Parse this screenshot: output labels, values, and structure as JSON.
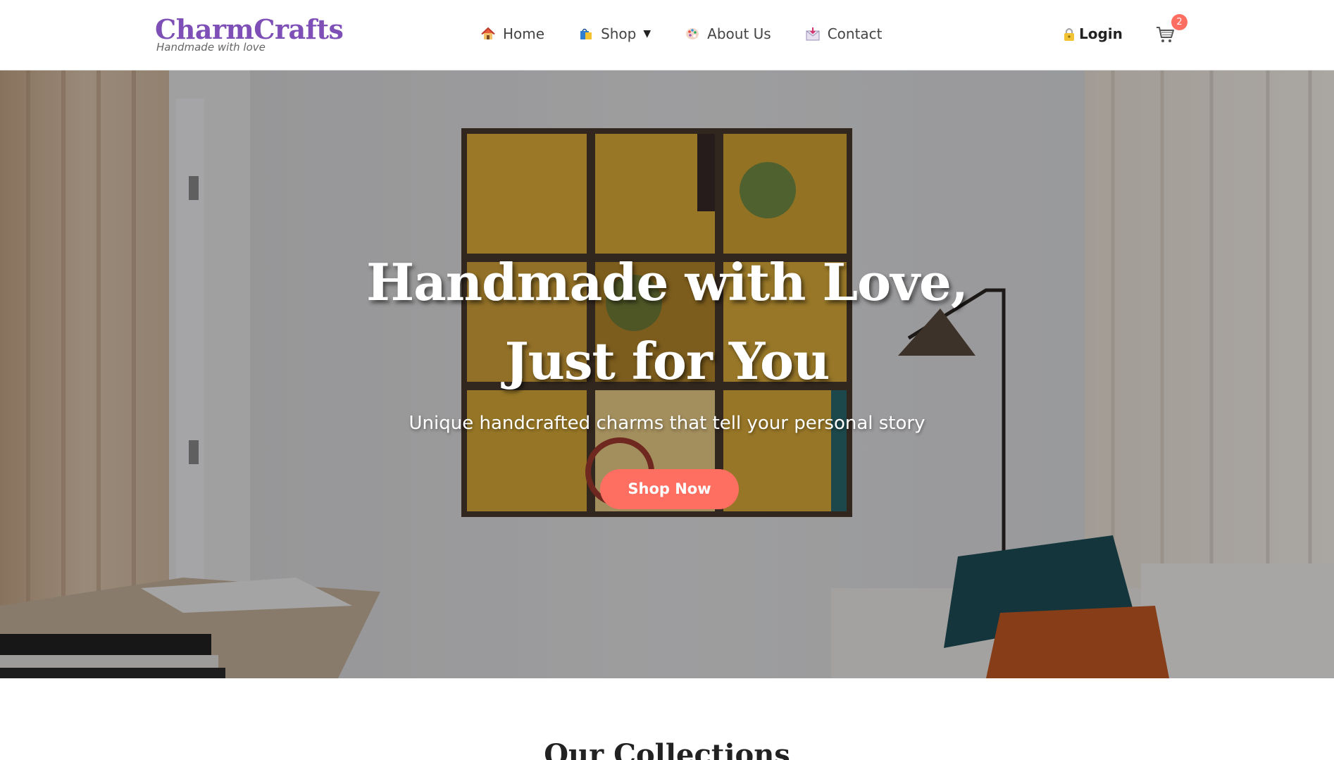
{
  "brand": {
    "name": "CharmCrafts",
    "tagline": "Handmade with love",
    "color": "#7e4fb6"
  },
  "nav": {
    "items": [
      {
        "label": "Home",
        "icon": "house-icon"
      },
      {
        "label": "Shop",
        "icon": "shopping-bag-icon",
        "caret": "▼"
      },
      {
        "label": "About Us",
        "icon": "palette-icon"
      },
      {
        "label": "Contact",
        "icon": "envelope-icon"
      }
    ],
    "login_label": "Login",
    "login_icon": "lock-icon",
    "cart_icon": "cart-icon",
    "cart_count": "2"
  },
  "hero": {
    "title": "Handmade with Love, Just for You",
    "subtitle": "Unique handcrafted charms that tell your personal story",
    "cta_label": "Shop Now",
    "accent": "#ff6f61"
  },
  "collections": {
    "title": "Our Collections"
  }
}
